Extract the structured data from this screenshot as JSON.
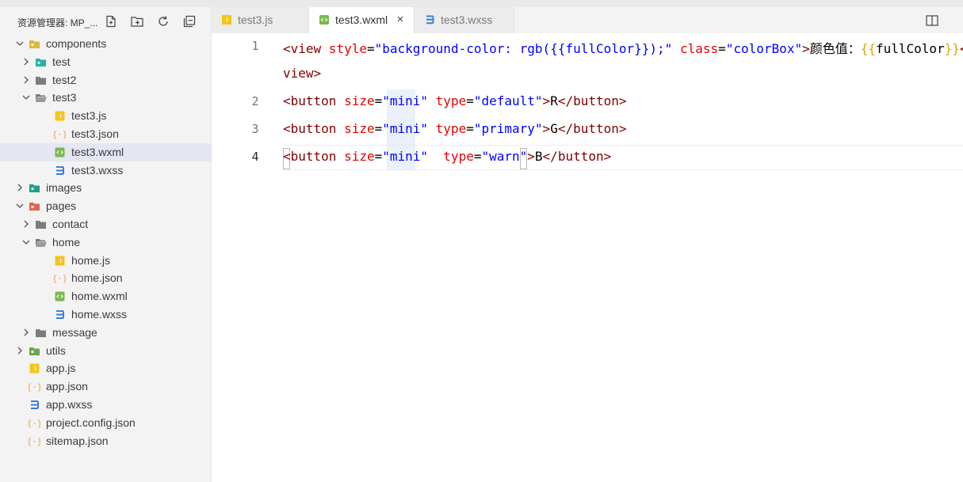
{
  "sidebar": {
    "title": "资源管理器: MP_...",
    "tree": [
      {
        "label": "components",
        "type": "folder-special",
        "icon_color": "#d9b93a",
        "expanded": true
      },
      {
        "label": "test",
        "type": "folder-special",
        "icon_color": "#24b3a6",
        "expanded": false
      },
      {
        "label": "test2",
        "type": "folder",
        "icon_color": "#7d7d7d",
        "expanded": false
      },
      {
        "label": "test3",
        "type": "folder-open",
        "icon_color": "#7d7d7d",
        "expanded": true
      },
      {
        "label": "test3.js",
        "type": "js",
        "icon_color": "#f5c518"
      },
      {
        "label": "test3.json",
        "type": "json",
        "icon_color": "#e8a33b"
      },
      {
        "label": "test3.wxml",
        "type": "wxml",
        "icon_color": "#79b94b",
        "selected": true
      },
      {
        "label": "test3.wxss",
        "type": "wxss",
        "icon_color": "#3b7fd6"
      },
      {
        "label": "images",
        "type": "folder-special",
        "icon_color": "#1f9e89",
        "expanded": false
      },
      {
        "label": "pages",
        "type": "folder-special",
        "icon_color": "#e5634e",
        "expanded": true
      },
      {
        "label": "contact",
        "type": "folder",
        "icon_color": "#7d7d7d",
        "expanded": false
      },
      {
        "label": "home",
        "type": "folder-open",
        "icon_color": "#7d7d7d",
        "expanded": true
      },
      {
        "label": "home.js",
        "type": "js",
        "icon_color": "#f5c518"
      },
      {
        "label": "home.json",
        "type": "json",
        "icon_color": "#e8a33b"
      },
      {
        "label": "home.wxml",
        "type": "wxml",
        "icon_color": "#79b94b"
      },
      {
        "label": "home.wxss",
        "type": "wxss",
        "icon_color": "#3b7fd6"
      },
      {
        "label": "message",
        "type": "folder",
        "icon_color": "#7d7d7d",
        "expanded": false
      },
      {
        "label": "utils",
        "type": "folder-special",
        "icon_color": "#6aa84f",
        "expanded": false
      },
      {
        "label": "app.js",
        "type": "js",
        "icon_color": "#f5c518"
      },
      {
        "label": "app.json",
        "type": "json",
        "icon_color": "#e8a33b"
      },
      {
        "label": "app.wxss",
        "type": "wxss",
        "icon_color": "#3b7fd6"
      },
      {
        "label": "project.config.json",
        "type": "json",
        "icon_color": "#e8a33b"
      },
      {
        "label": "sitemap.json",
        "type": "json",
        "icon_color": "#e8a33b"
      }
    ]
  },
  "tabs": [
    {
      "label": "test3.js",
      "icon": "js-file-icon",
      "active": false
    },
    {
      "label": "test3.wxml",
      "icon": "wxml-file-icon",
      "active": true,
      "close": "×"
    },
    {
      "label": "test3.wxss",
      "icon": "wxss-file-icon",
      "active": false
    }
  ],
  "editor": {
    "line_numbers": [
      "1",
      "2",
      "3",
      "4"
    ],
    "line1": {
      "p1": "<view ",
      "p2": "style",
      "p3": "=",
      "p4": "\"background-color: rgb({{fullColor}});\"",
      "p5": " ",
      "p6": "class",
      "p7": "=",
      "p8": "\"colorBox\"",
      "p9": ">",
      "p10": "颜色值：",
      "p11": "{{",
      "p12": "fullColor",
      "p13": "}}",
      "p14": "</"
    },
    "line1_wrap": "view>",
    "line2": {
      "p1": "<button ",
      "p2": "size",
      "p3": "=",
      "p4": "\"mini\"",
      "p5": " ",
      "p6": "type",
      "p7": "=",
      "p8": "\"default\"",
      "p9": ">",
      "p10": "R",
      "p11": "</button>"
    },
    "line3": {
      "p1": "<button ",
      "p2": "size",
      "p3": "=",
      "p4": "\"mini\"",
      "p5": " ",
      "p6": "type",
      "p7": "=",
      "p8": "\"primary\"",
      "p9": ">",
      "p10": "G",
      "p11": "</button>"
    },
    "line4": {
      "p1": "<button ",
      "p2": "size",
      "p3": "=",
      "p4": "\"mini\"",
      "p5": "  ",
      "p6": "type",
      "p7": "=",
      "p8": "\"warn\"",
      "p9": ">",
      "p10": "B",
      "p11": "</button>"
    }
  }
}
